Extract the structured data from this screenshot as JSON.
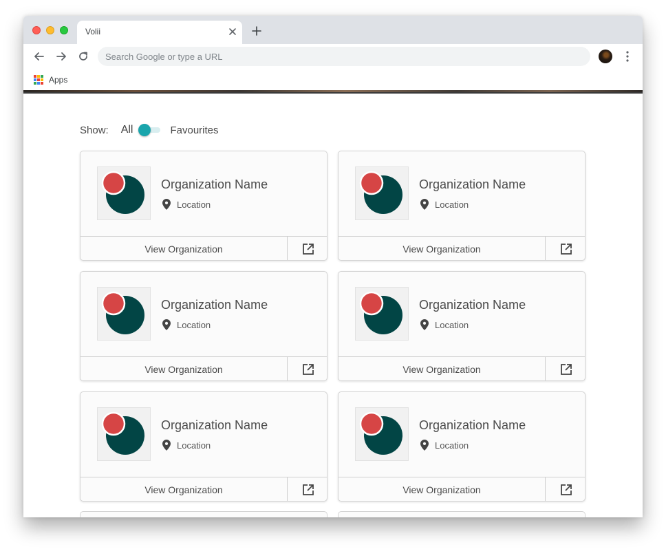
{
  "browser": {
    "tab_title": "Volii",
    "omnibox_placeholder": "Search Google or type a URL",
    "bookmarks": {
      "apps_label": "Apps"
    }
  },
  "filter": {
    "show_label": "Show:",
    "all_label": "All",
    "favourites_label": "Favourites",
    "toggle_state": "All"
  },
  "cards": [
    {
      "name": "Organization Name",
      "location": "Location",
      "view_label": "View Organization"
    },
    {
      "name": "Organization Name",
      "location": "Location",
      "view_label": "View Organization"
    },
    {
      "name": "Organization Name",
      "location": "Location",
      "view_label": "View Organization"
    },
    {
      "name": "Organization Name",
      "location": "Location",
      "view_label": "View Organization"
    },
    {
      "name": "Organization Name",
      "location": "Location",
      "view_label": "View Organization"
    },
    {
      "name": "Organization Name",
      "location": "Location",
      "view_label": "View Organization"
    }
  ],
  "colors": {
    "accent_teal": "#1aa5ac",
    "logo_dark": "#024545",
    "logo_red": "#d64545"
  },
  "icons": {
    "card_location": "map-pin-icon",
    "card_external": "external-link-icon"
  }
}
